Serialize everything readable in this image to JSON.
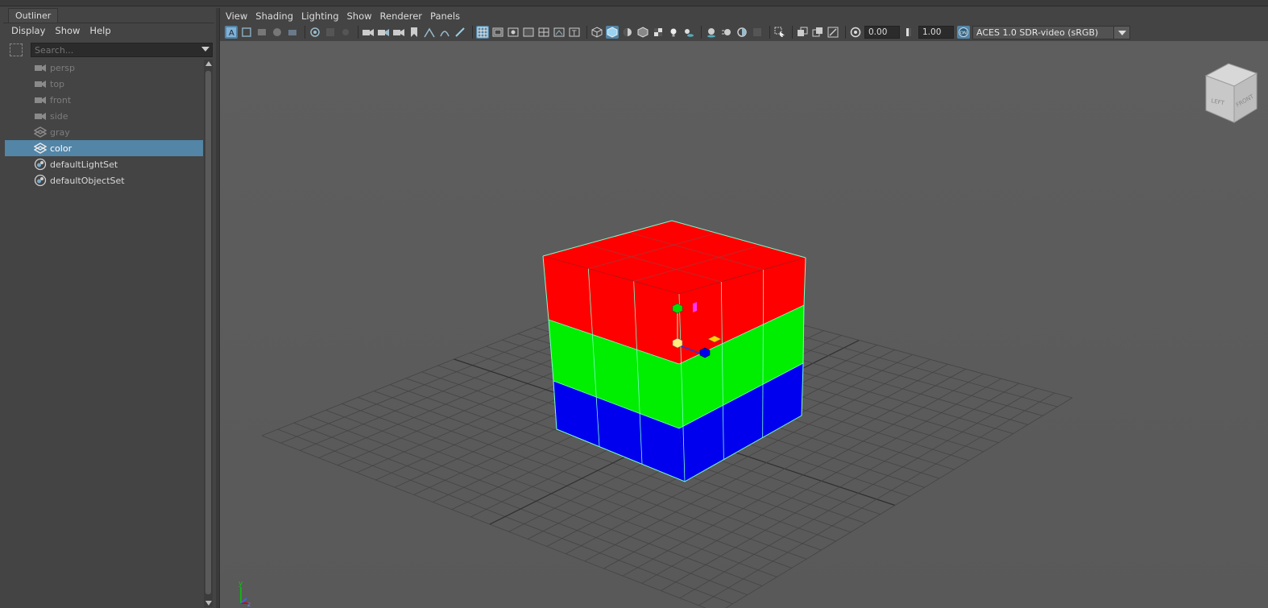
{
  "outliner": {
    "tab": "Outliner",
    "menu": [
      "Display",
      "Show",
      "Help"
    ],
    "search_placeholder": "Search...",
    "items": [
      {
        "label": "persp",
        "icon": "camera-icon",
        "state": "dim"
      },
      {
        "label": "top",
        "icon": "camera-icon",
        "state": "dim"
      },
      {
        "label": "front",
        "icon": "camera-icon",
        "state": "dim"
      },
      {
        "label": "side",
        "icon": "camera-icon",
        "state": "dim"
      },
      {
        "label": "gray",
        "icon": "material-set-icon",
        "state": "dim"
      },
      {
        "label": "color",
        "icon": "material-set-icon",
        "state": "selected"
      },
      {
        "label": "defaultLightSet",
        "icon": "object-set-icon",
        "state": "normal"
      },
      {
        "label": "defaultObjectSet",
        "icon": "object-set-icon",
        "state": "normal"
      }
    ]
  },
  "viewport_panel": {
    "menu": [
      "View",
      "Shading",
      "Lighting",
      "Show",
      "Renderer",
      "Panels"
    ],
    "exposure_value": "0.00",
    "gamma_value": "1.00",
    "color_space": "ACES 1.0 SDR-video (sRGB)"
  },
  "view_cube": {
    "left_label": "LEFT",
    "front_label": "FRONT"
  },
  "axis_indicator": {
    "y": "y",
    "z": "z"
  },
  "colors": {
    "selection": "#5285a6",
    "cube_top": "#ff0000",
    "cube_middle": "#00ee00",
    "cube_bottom": "#0000ee",
    "wireframe_highlight": "#7affc8"
  }
}
